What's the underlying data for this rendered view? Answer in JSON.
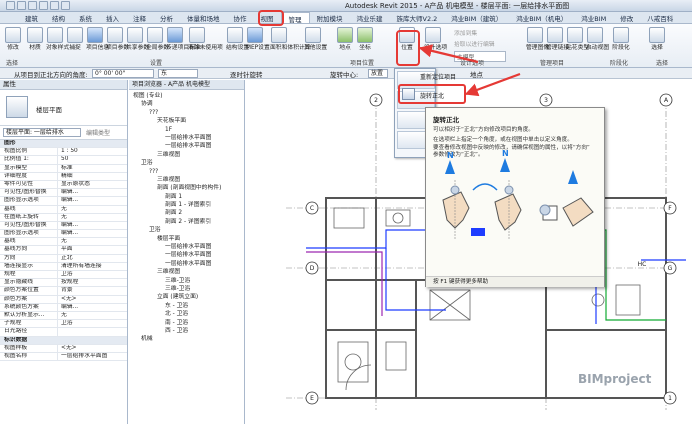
{
  "titlebar": {
    "title": "Autodesk Revit 2015 - A产品 机电模型 - 楼层平面: 一层给排水平面图",
    "qat_icons": [
      "open-icon",
      "save-icon",
      "undo-icon",
      "redo-icon",
      "print-icon",
      "measure-icon"
    ]
  },
  "tabs": [
    {
      "label": "建筑",
      "active": false
    },
    {
      "label": "结构",
      "active": false
    },
    {
      "label": "系统",
      "active": false
    },
    {
      "label": "插入",
      "active": false
    },
    {
      "label": "注释",
      "active": false
    },
    {
      "label": "分析",
      "active": false
    },
    {
      "label": "体量和场地",
      "active": false
    },
    {
      "label": "协作",
      "active": false
    },
    {
      "label": "视图",
      "active": false
    },
    {
      "label": "管理",
      "active": true
    },
    {
      "label": "附加模块",
      "active": false
    },
    {
      "label": "鸿业乐建",
      "active": false
    },
    {
      "label": "族库大师V2.2",
      "active": false
    },
    {
      "label": "鸿业BIM（建筑）",
      "active": false
    },
    {
      "label": "鸿业BIM（机电）",
      "active": false
    },
    {
      "label": "鸿业BIM",
      "active": false
    },
    {
      "label": "修改",
      "active": false
    },
    {
      "label": "八戒百科",
      "active": false
    }
  ],
  "ribbon": {
    "buttons": [
      {
        "label": "修改",
        "color": "plain"
      },
      {
        "label": "材质",
        "color": "plain"
      },
      {
        "label": "对象样式",
        "color": "plain"
      },
      {
        "label": "捕捉",
        "color": "plain"
      },
      {
        "label": "项目信息",
        "color": "blue"
      },
      {
        "label": "项目参数",
        "color": "plain"
      },
      {
        "label": "共享参数",
        "color": "plain"
      },
      {
        "label": "全局参数",
        "color": "plain"
      },
      {
        "label": "传递项目标准",
        "color": "blue"
      },
      {
        "label": "清除未使用项",
        "color": "plain"
      },
      {
        "label": "结构设置",
        "color": "plain"
      },
      {
        "label": "MEP设置",
        "color": "blue"
      },
      {
        "label": "面积和体积计算",
        "color": "plain"
      },
      {
        "label": "其他设置",
        "color": "plain"
      },
      {
        "label": "地点",
        "color": "grn"
      },
      {
        "label": "坐标",
        "color": "grn"
      },
      {
        "label": "位置",
        "color": "plain"
      },
      {
        "label": "设计选项",
        "color": "plain"
      },
      {
        "label": "管理图像",
        "color": "plain"
      },
      {
        "label": "管理链接",
        "color": "plain"
      },
      {
        "label": "贴花类型",
        "color": "plain"
      },
      {
        "label": "启动视图",
        "color": "plain"
      },
      {
        "label": "阶段化",
        "color": "plain"
      },
      {
        "label": "选择",
        "color": "plain"
      }
    ],
    "small_items": [
      "添加到集",
      "拾取以进行编辑",
      "主模型"
    ],
    "groups": [
      "选择",
      "设置",
      "项目位置",
      "设计选项",
      "管理项目",
      "阶段化",
      "选择"
    ]
  },
  "optionsbar": {
    "label1": "从项目到正北方向的角度:",
    "value1": "0° 00' 00\"",
    "label2": "东",
    "label3": "旋转中心:",
    "value3": "放置",
    "label4": "逐时针旋转",
    "label5": "地点"
  },
  "properties": {
    "title": "属性",
    "type_name": "楼层平面",
    "filter": "楼层平面: 一层给排水",
    "edit_type": "编辑类型",
    "rows": [
      {
        "k": "图形",
        "v": "",
        "sec": true
      },
      {
        "k": "视图比例",
        "v": "1 : 50"
      },
      {
        "k": "比例值 1:",
        "v": "50"
      },
      {
        "k": "显示模型",
        "v": "标准"
      },
      {
        "k": "详细程度",
        "v": "精细"
      },
      {
        "k": "零件可见性",
        "v": "显示原状态"
      },
      {
        "k": "可见性/图形替换",
        "v": "编辑..."
      },
      {
        "k": "图形显示选项",
        "v": "编辑..."
      },
      {
        "k": "基线",
        "v": "无"
      },
      {
        "k": "在图纸上旋转",
        "v": "无"
      },
      {
        "k": "可见性/图形替换",
        "v": "编辑..."
      },
      {
        "k": "图形显示选项",
        "v": "编辑..."
      },
      {
        "k": "基线",
        "v": "无"
      },
      {
        "k": "基线方向",
        "v": "平面"
      },
      {
        "k": "方向",
        "v": "正北"
      },
      {
        "k": "墙连接显示",
        "v": "清理所有墙连接"
      },
      {
        "k": "规程",
        "v": "卫浴"
      },
      {
        "k": "显示隐藏线",
        "v": "按规程"
      },
      {
        "k": "颜色方案位置",
        "v": "背景"
      },
      {
        "k": "颜色方案",
        "v": "<无>"
      },
      {
        "k": "系统颜色方案",
        "v": "编辑..."
      },
      {
        "k": "默认分析显示...",
        "v": "无"
      },
      {
        "k": "子规程",
        "v": "卫浴"
      },
      {
        "k": "日光路径",
        "v": ""
      },
      {
        "k": "标识数据",
        "v": "",
        "sec": true
      },
      {
        "k": "视图样板",
        "v": "<无>"
      },
      {
        "k": "视图名称",
        "v": "一层给排水平面图"
      }
    ]
  },
  "browser": {
    "title": "项目浏览器 - A产品 机电模型",
    "items": [
      {
        "t": "视图 (专业)",
        "d": 0
      },
      {
        "t": "协调",
        "d": 1
      },
      {
        "t": "???",
        "d": 2
      },
      {
        "t": "天花板平面",
        "d": 3
      },
      {
        "t": "1F",
        "d": 4
      },
      {
        "t": "一层给排水平面图",
        "d": 4
      },
      {
        "t": "一层给排水平面图",
        "d": 4
      },
      {
        "t": "三维视图",
        "d": 3
      },
      {
        "t": "卫浴",
        "d": 1
      },
      {
        "t": "???",
        "d": 2
      },
      {
        "t": "三维视图",
        "d": 3
      },
      {
        "t": "剖面 (剖面视图中的构件)",
        "d": 3
      },
      {
        "t": "剖面 1",
        "d": 4
      },
      {
        "t": "剖面 1 - 详图索引",
        "d": 4
      },
      {
        "t": "剖面 2",
        "d": 4
      },
      {
        "t": "剖面 2 - 详图索引",
        "d": 4
      },
      {
        "t": "卫浴",
        "d": 2
      },
      {
        "t": "楼层平面",
        "d": 3
      },
      {
        "t": "一层给排水平面图",
        "d": 4
      },
      {
        "t": "一层给排水平面图",
        "d": 4
      },
      {
        "t": "一层给排水平面图",
        "d": 4
      },
      {
        "t": "三维视图",
        "d": 3
      },
      {
        "t": "三维-卫浴",
        "d": 4
      },
      {
        "t": "三维-卫浴",
        "d": 4
      },
      {
        "t": "立面 (建筑立面)",
        "d": 3
      },
      {
        "t": "东 - 卫浴",
        "d": 4
      },
      {
        "t": "北 - 卫浴",
        "d": 4
      },
      {
        "t": "南 - 卫浴",
        "d": 4
      },
      {
        "t": "西 - 卫浴",
        "d": 4
      },
      {
        "t": "机械",
        "d": 1
      }
    ]
  },
  "dropdown": {
    "items": [
      "重新定位项目",
      "旋转正北",
      "镜像项目",
      "旋转项目北"
    ],
    "highlighted": "旋转正北"
  },
  "tooltip": {
    "title": "旋转正北",
    "lines": [
      "可以相对于“正北”方向修改项目的角度。",
      "",
      "在选项栏上指定一个角度，或在视图中单击以定义角度。",
      "",
      "要查看修改视图中反映的修改，请确保视图的属性，以将“方向”",
      "参数修改为“正北”。"
    ],
    "footer": "按 F1 键获得更多帮助",
    "north_label": "N"
  },
  "drawing": {
    "grid_labels": [
      "C",
      "D",
      "E",
      "F",
      "G",
      "1",
      "2",
      "3",
      "A",
      "B"
    ],
    "dim_labels": [
      "HC"
    ]
  },
  "watermark": "BIMproject",
  "colors": {
    "accent_red": "#e53935",
    "ribbon_blue": "#6b9ad6",
    "wall": "#555555",
    "pipe_blue": "#1e3cff",
    "pipe_green": "#11aa33",
    "pipe_purple": "#9c27b0"
  }
}
